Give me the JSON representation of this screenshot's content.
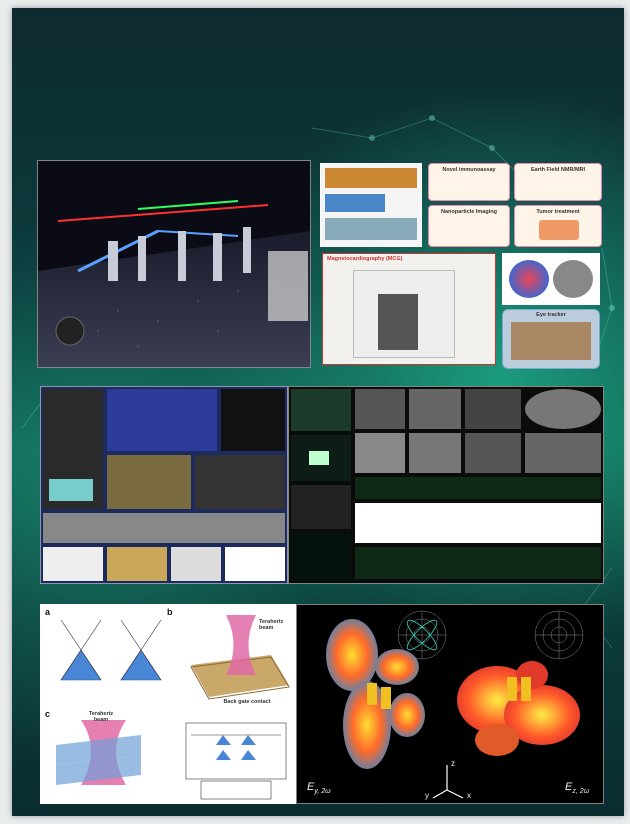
{
  "colors": {
    "background": "#0b3d3e",
    "glow": "#2fd7a6",
    "margin": "#e9ecec"
  },
  "meg_collage": {
    "tiles": [
      {
        "label": "Novel immunoassay"
      },
      {
        "label": "Earth Field NMR/MRI"
      },
      {
        "label": "Nanoparticle Imaging"
      },
      {
        "label": "Tumor treatment"
      }
    ],
    "meg_title": "Magnetocardiography (MCG)",
    "eye_tracker": "Eye tracker"
  },
  "panel_labels": [
    "a",
    "b",
    "c"
  ],
  "terahertz_labels": {
    "beam_b": "Terahertz beam",
    "beam_c": "Terahertz beam",
    "gate": "Back gate contact"
  },
  "radiation_labels": {
    "left": "E",
    "left_sub": "y, 2ω",
    "right": "E",
    "right_sub": "z, 2ω",
    "axis_z": "z",
    "axis_y": "y",
    "axis_x": "x"
  }
}
